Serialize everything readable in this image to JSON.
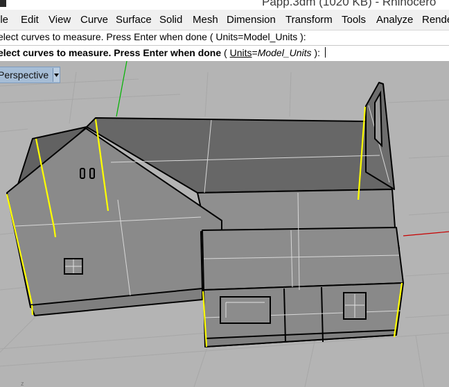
{
  "window": {
    "title": "Papp.3dm (1020 KB) - Rhinocero"
  },
  "menu": [
    "ile",
    "Edit",
    "View",
    "Curve",
    "Surface",
    "Solid",
    "Mesh",
    "Dimension",
    "Transform",
    "Tools",
    "Analyze",
    "Rende"
  ],
  "command": {
    "history": "elect curves to measure. Press Enter when done ( Units=Model_Units ):",
    "prompt_main": "elect curves to measure. Press Enter when done",
    "prompt_open": " ( ",
    "prompt_key": "Units",
    "prompt_eq": "=",
    "prompt_value": "Model_Units",
    "prompt_close": " ): "
  },
  "viewport": {
    "name": "Perspective"
  },
  "colors": {
    "selected_curve": "#ffff00",
    "grid_y_axis": "#00b400",
    "grid_x_axis": "#c80000",
    "background": "#b4b4b4"
  },
  "icons": [
    "app-icon",
    "chevron-down-icon"
  ]
}
